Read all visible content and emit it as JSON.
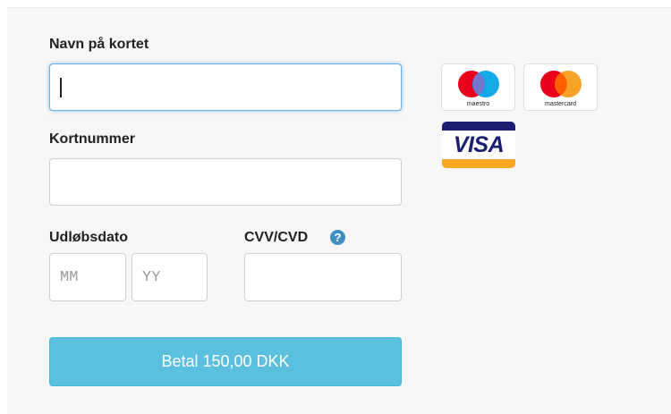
{
  "form": {
    "name_label": "Navn på kortet",
    "name_value": "",
    "card_number_label": "Kortnummer",
    "card_number_value": "",
    "expiry_label": "Udløbsdato",
    "expiry_month_placeholder": "MM",
    "expiry_year_placeholder": "YY",
    "cvv_label": "CVV/CVD",
    "cvv_help_icon": "question-circle-icon",
    "cvv_value": "",
    "pay_button_label": "Betal 150,00 DKK"
  },
  "card_logos": [
    {
      "name": "maestro",
      "caption": "maestro"
    },
    {
      "name": "mastercard",
      "caption": "mastercard"
    },
    {
      "name": "visa",
      "caption": "VISA"
    }
  ],
  "colors": {
    "focus_border": "#66afe9",
    "pay_button": "#5bc0de",
    "help_icon": "#3f8fc5"
  }
}
